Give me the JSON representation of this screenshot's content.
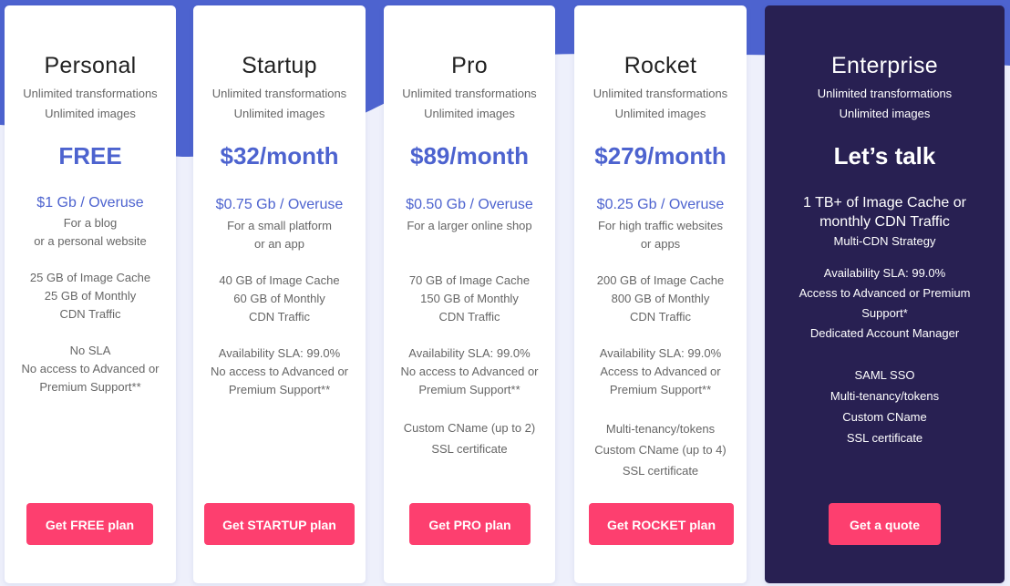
{
  "colors": {
    "wave_blue": "#4d63cf",
    "page_bg": "#eef0fb",
    "card_bg": "#ffffff",
    "enterprise_bg": "#282052",
    "price_blue": "#4d63cf",
    "button_pink": "#fd3f6f"
  },
  "plans": [
    {
      "name": "Personal",
      "features_top": [
        "Unlimited transformations",
        "Unlimited images"
      ],
      "price": "FREE",
      "overuse": "$1 Gb / Overuse",
      "audience": [
        "For a blog",
        "or a personal website"
      ],
      "storage": [
        "25 GB of Image Cache",
        "25 GB of Monthly",
        "CDN Traffic"
      ],
      "support": [
        "No SLA",
        "No access to Advanced or",
        "Premium Support**"
      ],
      "extras": [],
      "cta": "Get FREE plan"
    },
    {
      "name": "Startup",
      "features_top": [
        "Unlimited transformations",
        "Unlimited images"
      ],
      "price": "$32/month",
      "overuse": "$0.75 Gb / Overuse",
      "audience": [
        "For a small platform",
        "or an app"
      ],
      "storage": [
        "40 GB of Image Cache",
        "60 GB of Monthly",
        "CDN Traffic"
      ],
      "support": [
        "Availability SLA: 99.0%",
        "No access to Advanced or",
        "Premium Support**"
      ],
      "extras": [],
      "cta": "Get STARTUP plan"
    },
    {
      "name": "Pro",
      "features_top": [
        "Unlimited transformations",
        "Unlimited images"
      ],
      "price": "$89/month",
      "overuse": "$0.50 Gb / Overuse",
      "audience": [
        "For a larger online shop"
      ],
      "storage": [
        "70 GB of Image Cache",
        "150 GB of Monthly",
        "CDN Traffic"
      ],
      "support": [
        "Availability SLA: 99.0%",
        "No access to Advanced or",
        "Premium Support**"
      ],
      "extras": [
        "Custom CName (up to 2)",
        "SSL certificate"
      ],
      "cta": "Get PRO plan"
    },
    {
      "name": "Rocket",
      "features_top": [
        "Unlimited transformations",
        "Unlimited images"
      ],
      "price": "$279/month",
      "overuse": "$0.25 Gb / Overuse",
      "audience": [
        "For high traffic websites",
        "or apps"
      ],
      "storage": [
        "200 GB of Image Cache",
        "800 GB of Monthly",
        "CDN Traffic"
      ],
      "support": [
        "Availability SLA: 99.0%",
        "Access to Advanced or",
        "Premium Support**"
      ],
      "extras": [
        "Multi-tenancy/tokens",
        "Custom CName (up to 4)",
        "SSL certificate"
      ],
      "cta": "Get ROCKET plan"
    },
    {
      "name": "Enterprise",
      "features_top": [
        "Unlimited transformations",
        "Unlimited images"
      ],
      "price": "Let’s talk",
      "headline": [
        "1 TB+ of Image Cache or",
        "monthly CDN Traffic"
      ],
      "strategy": "Multi-CDN Strategy",
      "support": [
        "Availability SLA: 99.0%",
        "Access to Advanced or Premium",
        "Support*",
        "Dedicated Account Manager"
      ],
      "extras": [
        "SAML SSO",
        "Multi-tenancy/tokens",
        "Custom CName",
        "SSL certificate"
      ],
      "cta": "Get a quote"
    }
  ]
}
